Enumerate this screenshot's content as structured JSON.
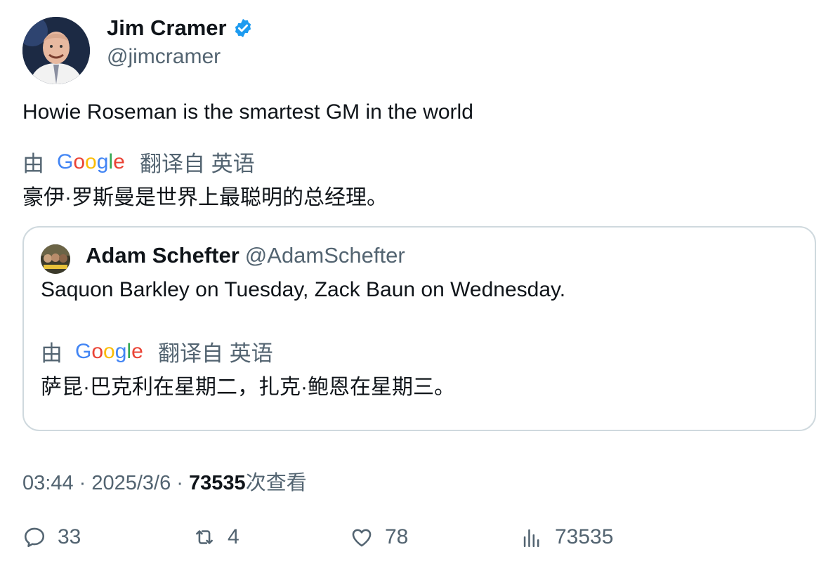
{
  "author": {
    "display_name": "Jim Cramer",
    "handle": "@jimcramer",
    "verified": true,
    "avatar_icon": "avatar-photo-icon"
  },
  "tweet": {
    "text": "Howie Roseman is the smartest GM in the world",
    "translate": {
      "prefix": "由",
      "provider": "Google",
      "suffix": "翻译自 英语"
    },
    "translated_text": "豪伊·罗斯曼是世界上最聪明的总经理。"
  },
  "quote": {
    "display_name": "Adam Schefter",
    "handle": "@AdamSchefter",
    "text": "Saquon Barkley on Tuesday, Zack Baun on Wednesday.",
    "translate": {
      "prefix": "由",
      "provider": "Google",
      "suffix": "翻译自 英语"
    },
    "translated_text": "萨昆·巴克利在星期二，扎克·鲍恩在星期三。"
  },
  "meta": {
    "time": "03:44",
    "sep1": " · ",
    "date": "2025/3/6",
    "sep2": " · ",
    "views_count": "73535",
    "views_label": "次查看"
  },
  "actions": {
    "reply_count": "33",
    "retweet_count": "4",
    "like_count": "78",
    "views_count": "73535"
  },
  "colors": {
    "text_primary": "#0f1419",
    "text_secondary": "#536471",
    "verified_blue": "#1d9bf0",
    "border": "#cfd9de"
  }
}
